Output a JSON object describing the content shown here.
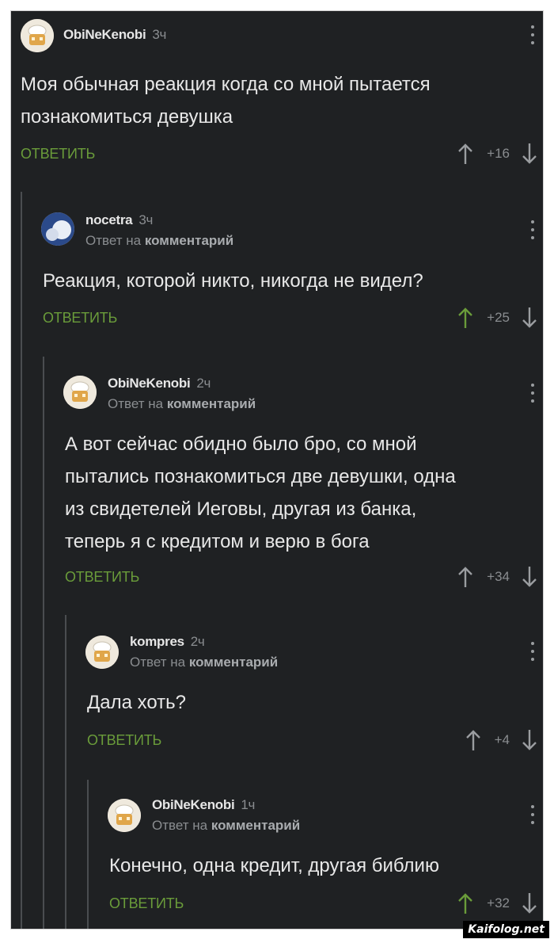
{
  "comments": [
    {
      "author": "ObiNeKenobi",
      "time": "3ч",
      "reply_to": "",
      "text_lines": [
        "Моя обычная реакция когда со мной пытается",
        "познакомиться девушка"
      ],
      "reply_label": "ОТВЕТИТЬ",
      "score": "+16",
      "upvoted": false,
      "avatar": "chef-avatar"
    },
    {
      "author": "nocetra",
      "time": "3ч",
      "reply_to_prefix": "Ответ на",
      "reply_to": "комментарий",
      "text_lines": [
        "Реакция, которой никто, никогда не видел?"
      ],
      "reply_label": "ОТВЕТИТЬ",
      "score": "+25",
      "upvoted": true,
      "avatar": "sky-avatar"
    },
    {
      "author": "ObiNeKenobi",
      "time": "2ч",
      "reply_to_prefix": "Ответ на",
      "reply_to": "комментарий",
      "text_lines": [
        "А вот сейчас обидно было бро, со мной",
        "пытались познакомиться две девушки, одна",
        "из свидетелей Иеговы, другая из банка,",
        "теперь я с кредитом и верю в бога"
      ],
      "reply_label": "ОТВЕТИТЬ",
      "score": "+34",
      "upvoted": false,
      "avatar": "chef-avatar"
    },
    {
      "author": "kompres",
      "time": "2ч",
      "reply_to_prefix": "Ответ на",
      "reply_to": "комментарий",
      "text_lines": [
        "Дала хоть?"
      ],
      "reply_label": "ОТВЕТИТЬ",
      "score": "+4",
      "upvoted": false,
      "avatar": "chef-avatar"
    },
    {
      "author": "ObiNeKenobi",
      "time": "1ч",
      "reply_to_prefix": "Ответ на",
      "reply_to": "комментарий",
      "text_lines": [
        "Конечно, одна кредит, другая библию"
      ],
      "reply_label": "ОТВЕТИТЬ",
      "score": "+32",
      "upvoted": true,
      "avatar": "chef-avatar"
    }
  ],
  "colors": {
    "background": "#1f2123",
    "accent_green": "#6a9c3a",
    "muted": "#8a8d90",
    "text": "#e8e8e8"
  },
  "watermark": "Kaifolog.net"
}
